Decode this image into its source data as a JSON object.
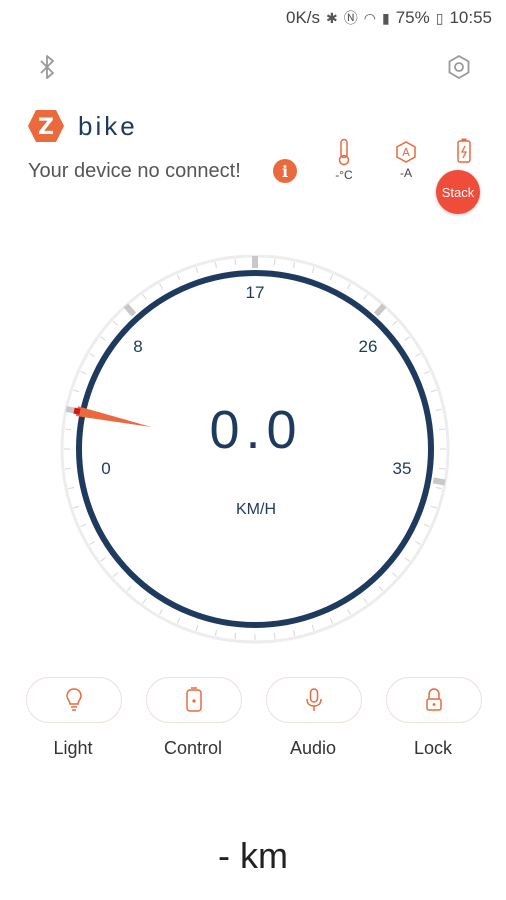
{
  "status_bar": {
    "speed": "0K/s",
    "battery": "75%",
    "time": "10:55"
  },
  "app": {
    "name": "bike",
    "logo_letter": "Z"
  },
  "connection": {
    "message": "Your device no connect!"
  },
  "stats": {
    "temperature": "-°C",
    "current": "-A",
    "stack_label": "Stack"
  },
  "gauge": {
    "value": "0.0",
    "unit": "KM/H",
    "ticks": [
      "0",
      "8",
      "17",
      "26",
      "35"
    ],
    "needle_speed": 0,
    "min": 0,
    "max": 35
  },
  "controls": [
    {
      "label": "Light",
      "icon": "lightbulb-icon"
    },
    {
      "label": "Control",
      "icon": "remote-icon"
    },
    {
      "label": "Audio",
      "icon": "microphone-icon"
    },
    {
      "label": "Lock",
      "icon": "lock-icon"
    }
  ],
  "odometer": {
    "text": "- km"
  },
  "colors": {
    "accent": "#ea6a3d",
    "navy": "#1e3a5f",
    "stack": "#f04c3a"
  }
}
